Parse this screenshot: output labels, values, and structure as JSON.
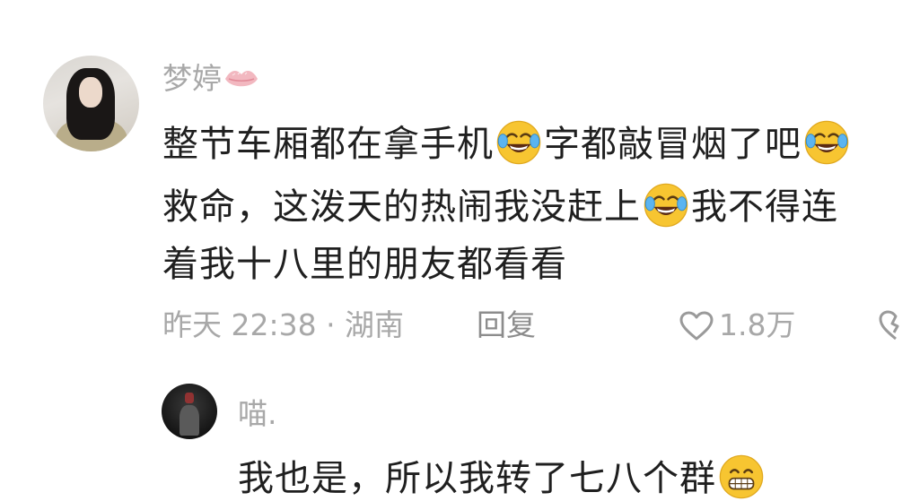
{
  "comments": [
    {
      "username": "梦婷",
      "text_lines": [
        [
          "整节车厢都在拿手机",
          "字都敲冒烟了吧"
        ],
        [
          "救命，这泼天的热闹我没赶上",
          "我不得连"
        ],
        [
          "着我十八里的朋友都看看"
        ]
      ],
      "time_location": "昨天 22:38 · 湖南",
      "reply_label": "回复",
      "like_count": "1.8万"
    }
  ],
  "reply": {
    "username": "喵.",
    "text": "我也是，所以我转了七八个群"
  },
  "icons": {
    "name_badge": "lips-icon",
    "laugh_cry": "laugh-cry-emoji",
    "grin": "grin-emoji",
    "like": "heart-outline-icon",
    "dislike": "broken-heart-icon"
  },
  "colors": {
    "text_primary": "#1f1f1f",
    "text_secondary": "#a8a8a8",
    "emoji_yellow": "#f7c531"
  }
}
